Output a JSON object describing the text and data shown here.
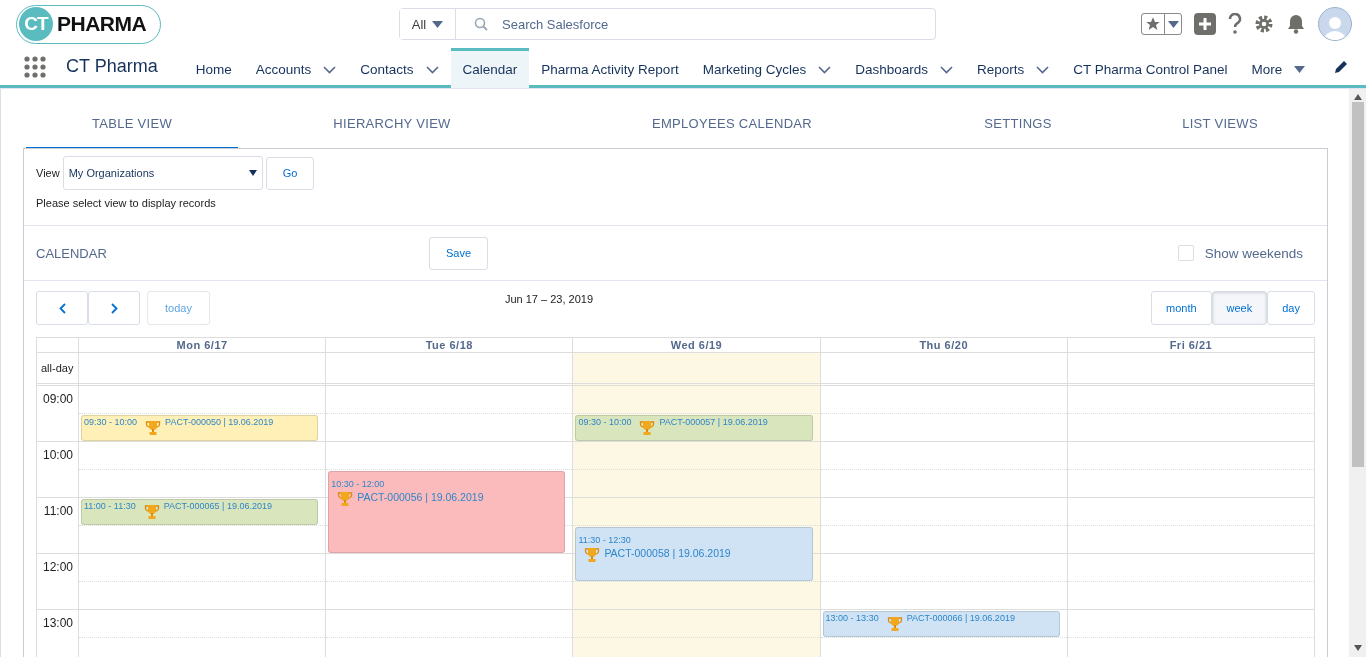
{
  "header": {
    "logo": {
      "badge": "CT",
      "text": "PHARMA"
    },
    "search": {
      "scope": "All",
      "placeholder": "Search Salesforce"
    }
  },
  "nav": {
    "app_name": "CT Pharma",
    "items": [
      {
        "label": "Home",
        "selected": false,
        "kind": "link",
        "dropdown": false
      },
      {
        "label": "Accounts",
        "selected": false,
        "kind": "link",
        "dropdown": true
      },
      {
        "label": "Contacts",
        "selected": false,
        "kind": "link",
        "dropdown": true
      },
      {
        "label": "Calendar",
        "selected": true,
        "kind": "link",
        "dropdown": false
      },
      {
        "label": "Pharma Activity Report",
        "selected": false,
        "kind": "link",
        "dropdown": false
      },
      {
        "label": "Marketing Cycles",
        "selected": false,
        "kind": "link",
        "dropdown": true
      },
      {
        "label": "Dashboards",
        "selected": false,
        "kind": "link",
        "dropdown": true
      },
      {
        "label": "Reports",
        "selected": false,
        "kind": "link",
        "dropdown": true
      },
      {
        "label": "CT Pharma Control Panel",
        "selected": false,
        "kind": "link",
        "dropdown": false
      },
      {
        "label": "More",
        "selected": false,
        "kind": "overflow",
        "dropdown": true
      }
    ]
  },
  "tabs": [
    {
      "label": "TABLE VIEW",
      "selected": true
    },
    {
      "label": "HIERARCHY VIEW",
      "selected": false
    },
    {
      "label": "EMPLOYEES CALENDAR",
      "selected": false
    },
    {
      "label": "SETTINGS",
      "selected": false
    },
    {
      "label": "LIST VIEWS",
      "selected": false
    }
  ],
  "view_filter": {
    "label": "View",
    "value": "My Organizations",
    "button": "Go",
    "hint": "Please select view to display records"
  },
  "calendar": {
    "title": "CALENDAR",
    "save": "Save",
    "show_weekends": {
      "label": "Show weekends",
      "checked": false
    },
    "today": "today",
    "range": "Jun 17 – 23, 2019",
    "modes": [
      {
        "label": "month",
        "selected": false
      },
      {
        "label": "week",
        "selected": true
      },
      {
        "label": "day",
        "selected": false
      }
    ],
    "all_day": "all-day",
    "hours": [
      "09:00",
      "10:00",
      "11:00",
      "12:00",
      "13:00"
    ],
    "days": [
      {
        "label": "Mon 6/17",
        "today": false,
        "events": [
          {
            "time": "09:30 - 10:00",
            "title": "PACT-000050 | 19.06.2019",
            "color": "#fef0b6"
          },
          {
            "time": "11:00 - 11:30",
            "title": "PACT-000065 | 19.06.2019",
            "color": "#d9e5bc"
          }
        ]
      },
      {
        "label": "Tue 6/18",
        "today": false,
        "events": [
          {
            "time": "10:30 - 12:00",
            "title": "PACT-000056 | 19.06.2019",
            "color": "#fbbbbd"
          }
        ]
      },
      {
        "label": "Wed 6/19",
        "today": true,
        "events": [
          {
            "time": "09:30 - 10:00",
            "title": "PACT-000057 | 19.06.2019",
            "color": "#d9e5bc"
          },
          {
            "time": "11:30 - 12:30",
            "title": "PACT-000058 | 19.06.2019",
            "color": "#cfe3f5"
          }
        ]
      },
      {
        "label": "Thu 6/20",
        "today": false,
        "events": [
          {
            "time": "13:00 - 13:30",
            "title": "PACT-000066 | 19.06.2019",
            "color": "#cfe3f5"
          }
        ]
      },
      {
        "label": "Fri 6/21",
        "today": false
      }
    ]
  }
}
